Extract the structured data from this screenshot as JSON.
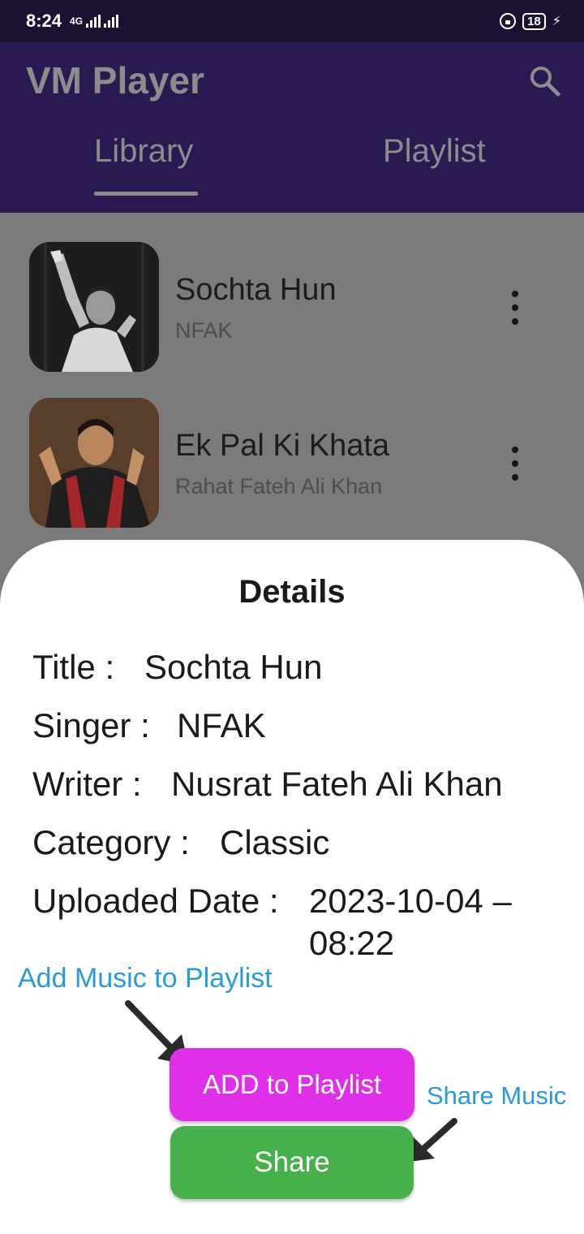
{
  "status_bar": {
    "time": "8:24",
    "network": "4G",
    "battery": "18"
  },
  "app": {
    "title": "VM Player",
    "tabs": [
      {
        "label": "Library",
        "selected": true
      },
      {
        "label": "Playlist",
        "selected": false
      }
    ]
  },
  "songs": [
    {
      "title": "Sochta Hun",
      "artist": "NFAK"
    },
    {
      "title": "Ek Pal Ki Khata",
      "artist": "Rahat Fateh Ali Khan"
    }
  ],
  "details": {
    "heading": "Details",
    "fields": [
      {
        "label": "Title :",
        "value": "Sochta Hun"
      },
      {
        "label": "Singer :",
        "value": "NFAK"
      },
      {
        "label": "Writer :",
        "value": "Nusrat Fateh Ali Khan"
      },
      {
        "label": "Category :",
        "value": "Classic"
      },
      {
        "label": "Uploaded Date :",
        "value_line1": "2023-10-04 –",
        "value_line2": "08:22"
      }
    ],
    "add_button": "ADD to Playlist",
    "share_button": "Share"
  },
  "annotations": {
    "add_hint": "Add Music to Playlist",
    "share_hint": "Share Music"
  },
  "colors": {
    "app_bar": "#2b1a52",
    "add_button": "#e02fe8",
    "share_button": "#46b04a",
    "annotation": "#2a9ad8"
  }
}
